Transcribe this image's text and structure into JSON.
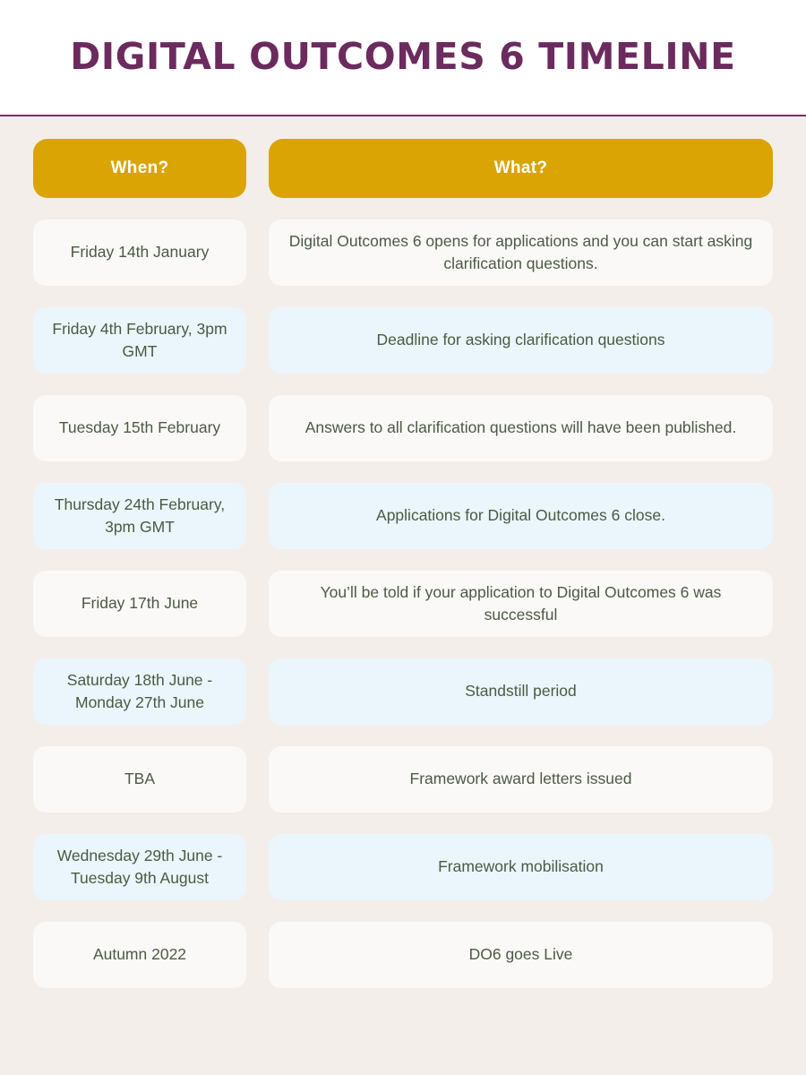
{
  "header": {
    "title": "Digital Outcomes 6 Timeline"
  },
  "colors": {
    "title_purple": "#6B2B5E",
    "rule_purple": "#7A3164",
    "page_background": "#F3EEE9",
    "header_pill_amber": "#D9A404",
    "header_pill_text": "#FFFFFF",
    "cell_light": "#FAF9F8",
    "cell_blue": "#EAF6FC",
    "cell_text": "#4C5A43"
  },
  "table": {
    "columns": [
      {
        "label": "When?"
      },
      {
        "label": "What?"
      }
    ],
    "rows": [
      {
        "when": "Friday 14th January",
        "what": "Digital Outcomes 6 opens for applications and you can start asking clarification questions.",
        "variant": "light"
      },
      {
        "when": "Friday 4th February, 3pm GMT",
        "what": "Deadline for asking clarification questions",
        "variant": "blue"
      },
      {
        "when": "Tuesday 15th February",
        "what": "Answers to all clarification questions will have been published.",
        "variant": "light"
      },
      {
        "when": "Thursday 24th February, 3pm GMT",
        "what": "Applications for Digital Outcomes 6 close.",
        "variant": "blue"
      },
      {
        "when": "Friday 17th June",
        "what": "You’ll be told if your application to Digital Outcomes 6 was successful",
        "variant": "light"
      },
      {
        "when": "Saturday 18th June - Monday 27th June",
        "what": "Standstill period",
        "variant": "blue"
      },
      {
        "when": "TBA",
        "what": "Framework award letters issued",
        "variant": "light"
      },
      {
        "when": "Wednesday 29th June - Tuesday 9th August",
        "what": "Framework mobilisation",
        "variant": "blue"
      },
      {
        "when": "Autumn 2022",
        "what": "DO6 goes Live",
        "variant": "light"
      }
    ]
  }
}
